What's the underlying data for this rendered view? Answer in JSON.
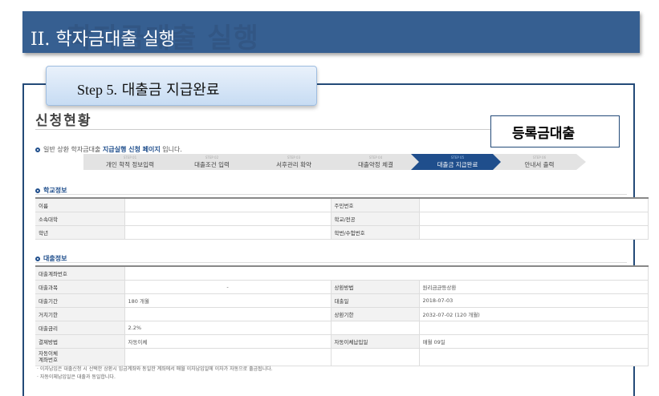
{
  "slide": {
    "title_roman": "II.",
    "title_text": "학자금대출 실행",
    "ghost_text": "학자금대출 실행"
  },
  "step_box": {
    "en": "Step 5.",
    "ko": "대출금 지급완료"
  },
  "page": {
    "heading": "신청현황",
    "loan_type": "등록금대출",
    "notice_prefix": "일반 상환 학자금대출 ",
    "notice_highlight": "지급실행 신청 페이지",
    "notice_suffix": " 입니다."
  },
  "steps": [
    {
      "num": "STEP 01",
      "label": "개인 학적 정보입력"
    },
    {
      "num": "STEP 02",
      "label": "대출조건 입력"
    },
    {
      "num": "STEP 03",
      "label": "서후관리 확약"
    },
    {
      "num": "STEP 04",
      "label": "대출약정 체결"
    },
    {
      "num": "STEP 05",
      "label": "대출금 지급완료"
    },
    {
      "num": "STEP 06",
      "label": "안내서 출력"
    }
  ],
  "school_section": {
    "title": "학교정보",
    "rows": [
      {
        "l1": "이름",
        "v1": "",
        "l2": "주민번호",
        "v2": ""
      },
      {
        "l1": "소속대학",
        "v1": "",
        "l2": "학교/전공",
        "v2": ""
      },
      {
        "l1": "학년",
        "v1": "",
        "l2": "학번/수험번호",
        "v2": ""
      }
    ]
  },
  "loan_section": {
    "title": "대출정보",
    "account_label": "대출계좌번호",
    "account_value": "",
    "rows": [
      {
        "l1": "대출과목",
        "v1": "-",
        "l2": "상환방법",
        "v2": "원리금균등상환"
      },
      {
        "l1": "대출기간",
        "v1": "180 개월",
        "l2": "대출일",
        "v2": "2018-07-03"
      },
      {
        "l1": "거치기한",
        "v1": "",
        "l2": "상환기한",
        "v2": "2032-07-02 (120 개월)"
      },
      {
        "l1": "대출금리",
        "v1": "2.2%",
        "l2": "",
        "v2": ""
      },
      {
        "l1": "결제방법",
        "v1": "자동이체",
        "l2": "자동이체납입일",
        "v2": "매월 09일"
      }
    ],
    "last_label_1": "자동이체",
    "last_label_2": "계좌번호",
    "last_value": ""
  },
  "footnotes": [
    "· 이자납입은 대출신청 시 선택한 상환시 입금계좌와 동일한 계좌에서 매월 이자납입일에 이자가 자동으로 출금됩니다.",
    "· 자동이체납입일은 대출과 동일합니다."
  ]
}
